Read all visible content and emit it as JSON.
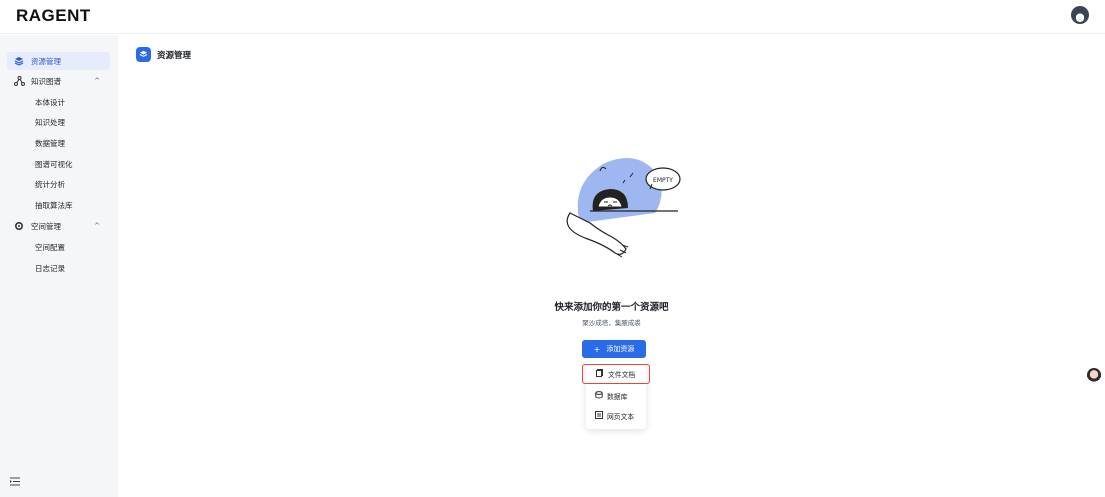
{
  "app": {
    "logo": "RAGENT"
  },
  "sidebar": {
    "items": [
      {
        "label": "资源管理",
        "icon": "layers-icon",
        "active": true
      },
      {
        "label": "知识图谱",
        "icon": "graph-nodes-icon",
        "expanded": true,
        "children": [
          "本体设计",
          "知识处理",
          "数据管理",
          "图谱可视化",
          "统计分析",
          "抽取算法库"
        ]
      },
      {
        "label": "空间管理",
        "icon": "gear-icon",
        "expanded": true,
        "children": [
          "空间配置",
          "日志记录"
        ]
      }
    ],
    "caret": "^",
    "collapse_icon": "menu-collapse-icon"
  },
  "page": {
    "title": "资源管理",
    "title_icon": "layers-icon"
  },
  "empty_state": {
    "illustration_text": "EMPTY",
    "title": "快来添加你的第一个资源吧",
    "subtitle": "聚沙成塔，集腋成裘"
  },
  "add_button": {
    "plus": "+",
    "label": "添加资源"
  },
  "add_menu": {
    "items": [
      {
        "label": "文件文档",
        "icon": "document-icon",
        "highlighted": true
      },
      {
        "label": "数据库",
        "icon": "database-icon"
      },
      {
        "label": "网页文本",
        "icon": "web-text-icon"
      }
    ]
  },
  "colors": {
    "primary": "#2a6be8",
    "highlight_border": "#e0483e",
    "active_bg": "#e6ecfb"
  }
}
